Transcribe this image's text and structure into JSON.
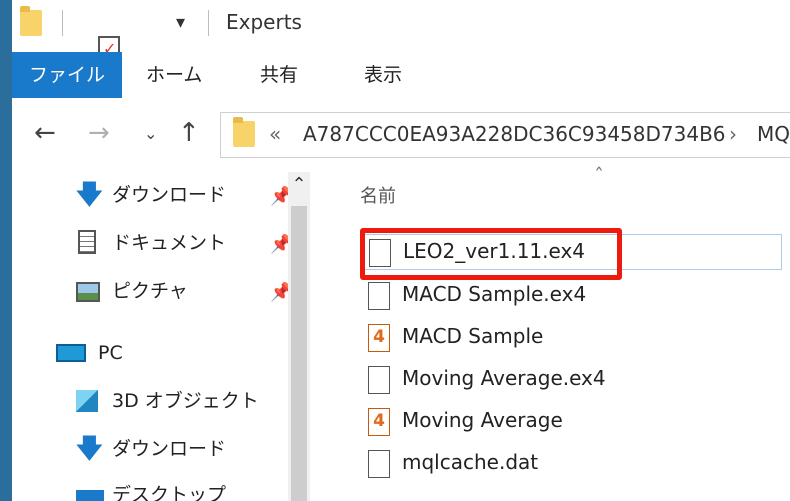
{
  "window": {
    "title": "Experts"
  },
  "ribbon": {
    "tabs": [
      {
        "label": "ファイル",
        "active": true
      },
      {
        "label": "ホーム",
        "active": false
      },
      {
        "label": "共有",
        "active": false
      },
      {
        "label": "表示",
        "active": false
      }
    ]
  },
  "nav": {
    "back_icon": "arrow-left-icon",
    "forward_icon": "arrow-right-icon",
    "recent_icon": "chevron-down-icon",
    "up_icon": "arrow-up-icon"
  },
  "address": {
    "overflow": "«",
    "path": [
      "A787CCC0EA93A228DC36C93458D734B6",
      "MQ"
    ],
    "separator": "›"
  },
  "sidebar": {
    "quick_access": [
      {
        "label": "ダウンロード",
        "icon": "download-arrow-icon",
        "pinned": true
      },
      {
        "label": "ドキュメント",
        "icon": "document-icon",
        "pinned": true
      },
      {
        "label": "ピクチャ",
        "icon": "picture-icon",
        "pinned": true
      }
    ],
    "pc": {
      "label": "PC",
      "icon": "computer-icon"
    },
    "pc_items": [
      {
        "label": "3D オブジェクト",
        "icon": "cube-icon"
      },
      {
        "label": "ダウンロード",
        "icon": "download-arrow-icon"
      },
      {
        "label": "デスクトップ",
        "icon": "desktop-icon"
      }
    ]
  },
  "content": {
    "column_header": "名前",
    "files": [
      {
        "name": "LEO2_ver1.11.ex4",
        "icon": "file-icon",
        "highlighted": true
      },
      {
        "name": "MACD Sample.ex4",
        "icon": "file-icon"
      },
      {
        "name": "MACD Sample",
        "icon": "mq4-icon"
      },
      {
        "name": "Moving Average.ex4",
        "icon": "file-icon"
      },
      {
        "name": "Moving Average",
        "icon": "mq4-icon"
      },
      {
        "name": "mqlcache.dat",
        "icon": "file-icon"
      }
    ]
  },
  "colors": {
    "accent": "#1979ca",
    "highlight": "#ef1a0e",
    "frame": "#2b6e9c"
  }
}
